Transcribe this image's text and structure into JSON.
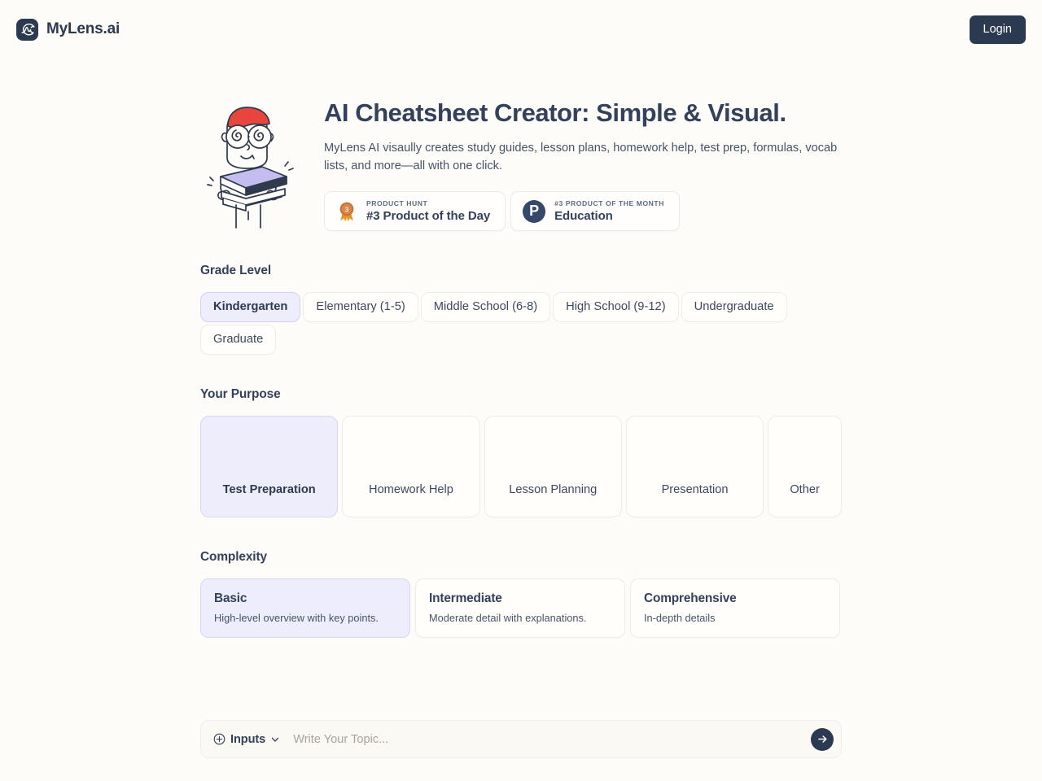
{
  "header": {
    "brand_name": "MyLens.ai",
    "brand_logo_icon": "mylens-mountain-logo-icon",
    "login_label": "Login"
  },
  "hero": {
    "mascot_icon": "student-with-books-illustration",
    "title": "AI Cheatsheet Creator: Simple & Visual.",
    "subtitle": "MyLens AI visaully creates study guides, lesson plans, homework help, test prep, formulas, vocab lists, and more—all with one click.",
    "badges": [
      {
        "icon": "bronze-medal-icon",
        "medal_rank": "3",
        "kicker": "PRODUCT HUNT",
        "title": "#3 Product of the Day"
      },
      {
        "icon": "product-hunt-p-icon",
        "medal_rank": "P",
        "kicker": "#3 PRODUCT OF THE MONTH",
        "title": "Education"
      }
    ]
  },
  "grade_level": {
    "label": "Grade Level",
    "selected": "Kindergarten",
    "options": [
      "Kindergarten",
      "Elementary (1-5)",
      "Middle School (6-8)",
      "High School (9-12)",
      "Undergraduate",
      "Graduate"
    ]
  },
  "purpose": {
    "label": "Your Purpose",
    "selected": "Test Preparation",
    "options": [
      "Test Preparation",
      "Homework Help",
      "Lesson Planning",
      "Presentation",
      "Other"
    ]
  },
  "complexity": {
    "label": "Complexity",
    "selected": "Basic",
    "options": [
      {
        "title": "Basic",
        "desc": "High-level overview with key points."
      },
      {
        "title": "Intermediate",
        "desc": "Moderate detail with explanations."
      },
      {
        "title": "Comprehensive",
        "desc": "In-depth details"
      }
    ]
  },
  "composer": {
    "plus_icon": "plus-circle-icon",
    "inputs_label": "Inputs",
    "chevron_icon": "chevron-down-icon",
    "topic_value": "",
    "topic_placeholder": "Write Your Topic...",
    "send_icon": "arrow-right-icon"
  },
  "colors": {
    "page_background": "#fdfcf8",
    "ink": "#33415c",
    "accent_navy": "#2b3a50",
    "selected_fill": "#eeedfc",
    "selected_border": "#d7d6f7",
    "card_border": "#efece5",
    "medal_bronze": "#c8763a",
    "cap_red": "#e8453c",
    "book_purple": "#c4bdf0"
  }
}
